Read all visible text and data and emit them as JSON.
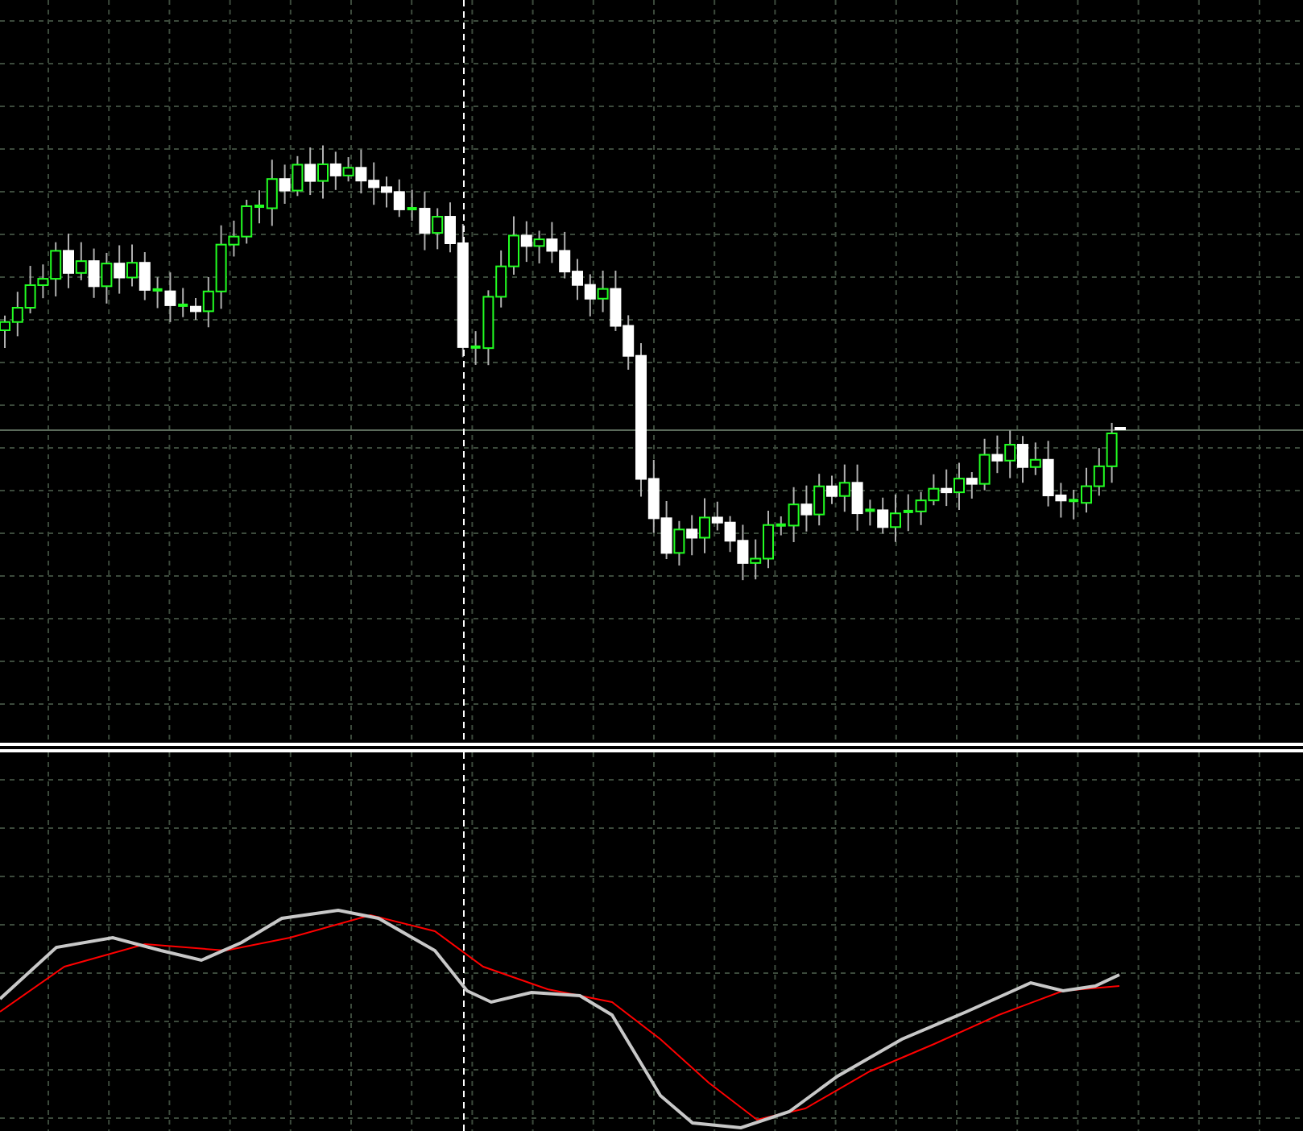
{
  "main_chart": {
    "kind": "candlestick"
  },
  "indicator": {
    "kind": "oscillator"
  }
}
